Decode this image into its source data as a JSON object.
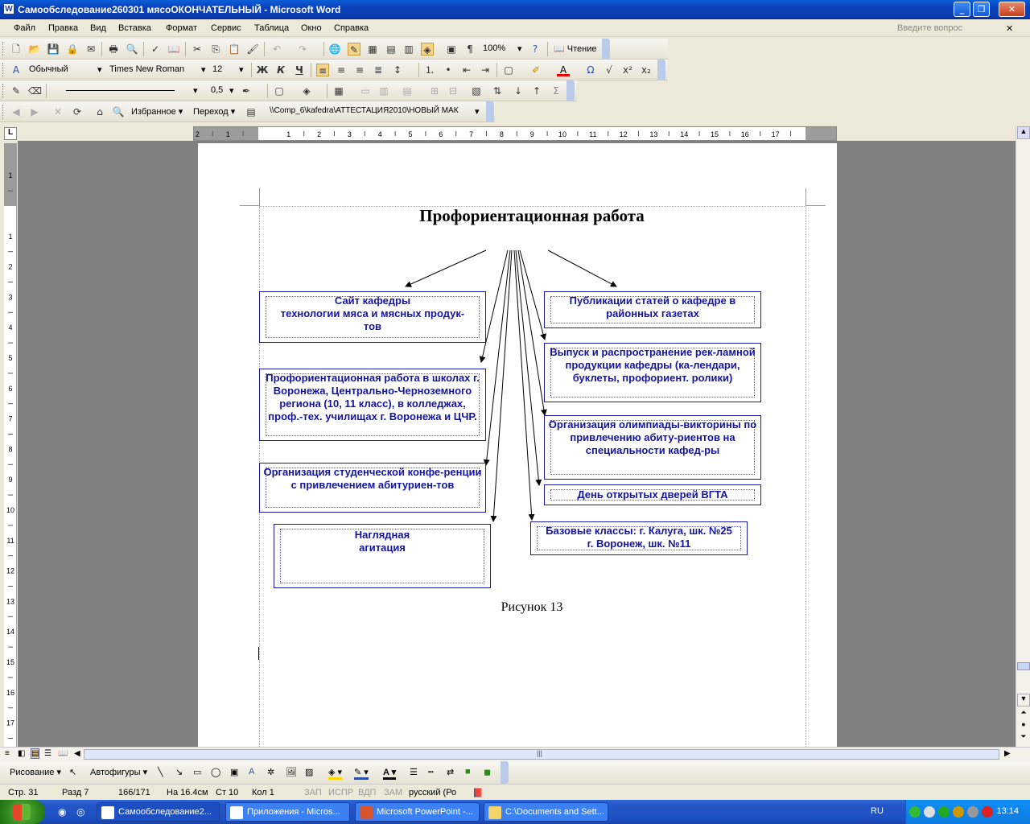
{
  "window": {
    "title": "Самообследование260301 мясоОКОНЧАТЕЛЬНЫЙ - Microsoft Word",
    "icon": "W"
  },
  "menu": {
    "items": [
      "Файл",
      "Правка",
      "Вид",
      "Вставка",
      "Формат",
      "Сервис",
      "Таблица",
      "Окно",
      "Справка"
    ],
    "ask_placeholder": "Введите вопрос"
  },
  "toolbar1": {
    "zoom": "100%",
    "reading": "Чтение"
  },
  "toolbar2": {
    "style": "Обычный",
    "font": "Times New Roman",
    "size": "12",
    "bold": "Ж",
    "italic": "К",
    "underline": "Ч"
  },
  "toolbar3": {
    "line_width": "0,5"
  },
  "web": {
    "favorites": "Избранное",
    "goto": "Переход",
    "address": "\\\\Comp_6\\kafedra\\АТТЕСТАЦИЯ2010\\НОВЫЙ МАК"
  },
  "ruler": {
    "h_labels": [
      "2",
      "1",
      "1",
      "2",
      "3",
      "4",
      "5",
      "6",
      "7",
      "8",
      "9",
      "10",
      "11",
      "12",
      "13",
      "14",
      "15",
      "16",
      "17"
    ],
    "v_labels": [
      "1",
      "1",
      "2",
      "3",
      "4",
      "5",
      "6",
      "7",
      "8",
      "9",
      "10",
      "11",
      "12",
      "13",
      "14",
      "15",
      "16",
      "17"
    ]
  },
  "document": {
    "heading": "Профориентационная работа",
    "caption": "Рисунок 13",
    "boxes": {
      "site": "Сайт кафедры\nтехнологии мяса и мясных продук-\nтов",
      "schools": "Профориентационная работа в школах г. Воронежа, Центрально-Черноземного региона (10, 11 класс), в колледжах, проф.-тех. училищах г. Воронежа и ЦЧР.",
      "conference": "Организация студенческой конфе-ренции с привлечением абитуриен-тов",
      "agitation": "Наглядная\nагитация",
      "articles": "Публикации статей о кафедре в районных газетах",
      "advert": "Выпуск и распространение рек-ламной продукции кафедры (ка-лендари, буклеты, профориент. ролики)",
      "olympiad": "Организация олимпиады-викторины по привлечению абиту-риентов на специальности кафед-ры",
      "openday": "День открытых дверей ВГТА",
      "classes": "Базовые классы: г. Калуга, шк. №25\nг. Воронеж, шк. №11"
    }
  },
  "drawing": {
    "draw": "Рисование",
    "autoshapes": "Автофигуры"
  },
  "status": {
    "page": "Стр.  31",
    "section": "Разд  7",
    "pages": "166/171",
    "at": "На  16.4см",
    "line": "Ст  10",
    "col": "Кол  1",
    "rec": "ЗАП",
    "trk": "ИСПР",
    "ext": "ВДП",
    "ovr": "ЗАМ",
    "lang": "русский (Ро"
  },
  "taskbar": {
    "tasks": [
      "Самообследование2...",
      "Приложения - Micros...",
      "Microsoft PowerPoint -...",
      "C:\\Documents and Sett..."
    ],
    "lang": "RU",
    "clock": "13:14"
  }
}
